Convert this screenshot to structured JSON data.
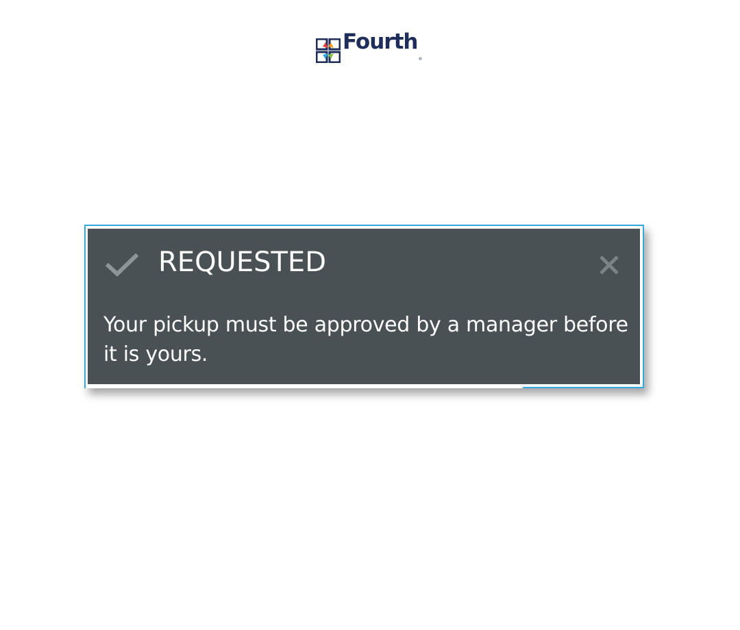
{
  "logo": {
    "wordmark": "Fourth",
    "registered": "®",
    "mark_icon": "fourth-logo-mark-icon"
  },
  "toast": {
    "status_icon": "checkmark-icon",
    "title": "REQUESTED",
    "message": "Your pickup must be approved by a manager before it is yours.",
    "close_icon": "close-icon",
    "colors": {
      "background": "#4a5154",
      "border_accent": "#34a9de",
      "text": "#ffffff",
      "icon": "#8e9598"
    }
  },
  "colors": {
    "brand_navy": "#1e2d5a",
    "logo_red": "#e0403a",
    "logo_orange": "#f39a1e",
    "logo_green": "#7fc241",
    "logo_blue": "#2aa7df"
  }
}
